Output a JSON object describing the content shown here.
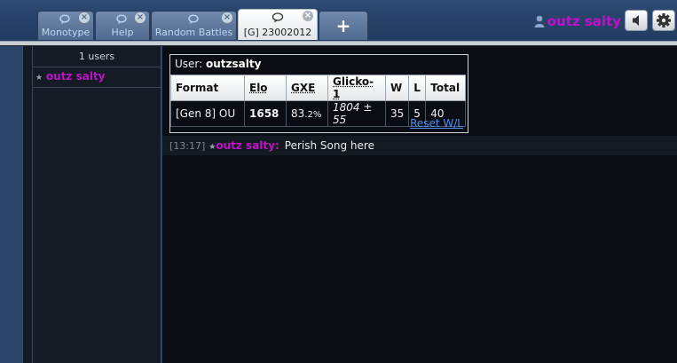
{
  "tabs": [
    {
      "label": "Monotype",
      "icon": "chat-bubbles-icon",
      "active": false
    },
    {
      "label": "Help",
      "icon": "chat-bubbles-icon",
      "active": false
    },
    {
      "label": "Random Battles",
      "icon": "chat-bubbles-icon",
      "active": false
    },
    {
      "label": "[G] 23002012",
      "icon": "chat-bubble-icon",
      "active": true
    }
  ],
  "new_tab_label": "+",
  "header": {
    "username": "outz salty",
    "buttons": [
      "volume-icon",
      "gear-icon"
    ]
  },
  "userlist": {
    "count": "1 users",
    "users": [
      {
        "rank": "★",
        "name": "outz salty"
      }
    ]
  },
  "ranking": {
    "user_prefix": "User:",
    "user": "outzsalty",
    "columns": [
      "Format",
      "Elo",
      "GXE",
      "Glicko-1",
      "W",
      "L",
      "Total"
    ],
    "row": {
      "format": "[Gen 8] OU",
      "elo": "1658",
      "gxe": "83",
      "gxe_decimal": ".2%",
      "glicko": "1804 ± 55",
      "w": "35",
      "l": "5",
      "total": "40"
    },
    "reset_label": "Reset W/L"
  },
  "message": {
    "time": "[13:17]",
    "rank": "★",
    "author": "outz salty:",
    "text": "Perish Song here"
  },
  "colors": {
    "username": "#c010c8",
    "link": "#4f8cf0",
    "chat_bg": "#0a0d14",
    "header_bg": "#243a5c"
  }
}
